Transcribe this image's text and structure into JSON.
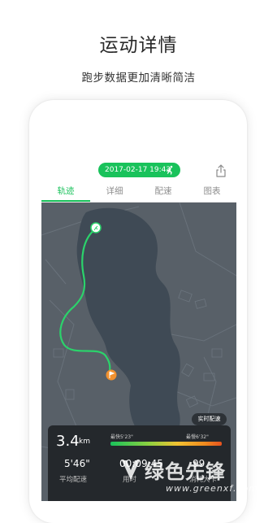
{
  "header": {
    "title": "运动详情",
    "subtitle": "跑步数据更加清晰简洁"
  },
  "toolbar": {
    "datetime": "2017-02-17 19:43",
    "runner_icon": "runner-icon",
    "share_icon": "share-icon"
  },
  "tabs": [
    {
      "label": "轨迹",
      "active": true
    },
    {
      "label": "详细",
      "active": false
    },
    {
      "label": "配速",
      "active": false
    },
    {
      "label": "图表",
      "active": false
    }
  ],
  "map": {
    "realtime_pace_label": "实时配速",
    "start_marker_icon": "runner-marker-icon",
    "finish_marker_icon": "flag-marker-icon"
  },
  "stats": {
    "distance_value": "3.4",
    "distance_unit": "km",
    "pace_fastest_label": "最快5'23\"",
    "pace_slowest_label": "最慢6'32\"",
    "avg_pace_value": "5'46\"",
    "avg_pace_label": "平均配速",
    "time_value": "00:09:45",
    "time_label": "用时",
    "calories_value": "99",
    "calories_label": "消耗大卡"
  },
  "watermark": {
    "name": "绿色先锋",
    "url": "www.greenxf.com"
  },
  "colors": {
    "accent": "#19c25b",
    "map_bg": "#586068",
    "stats_bg": "#24282c"
  }
}
